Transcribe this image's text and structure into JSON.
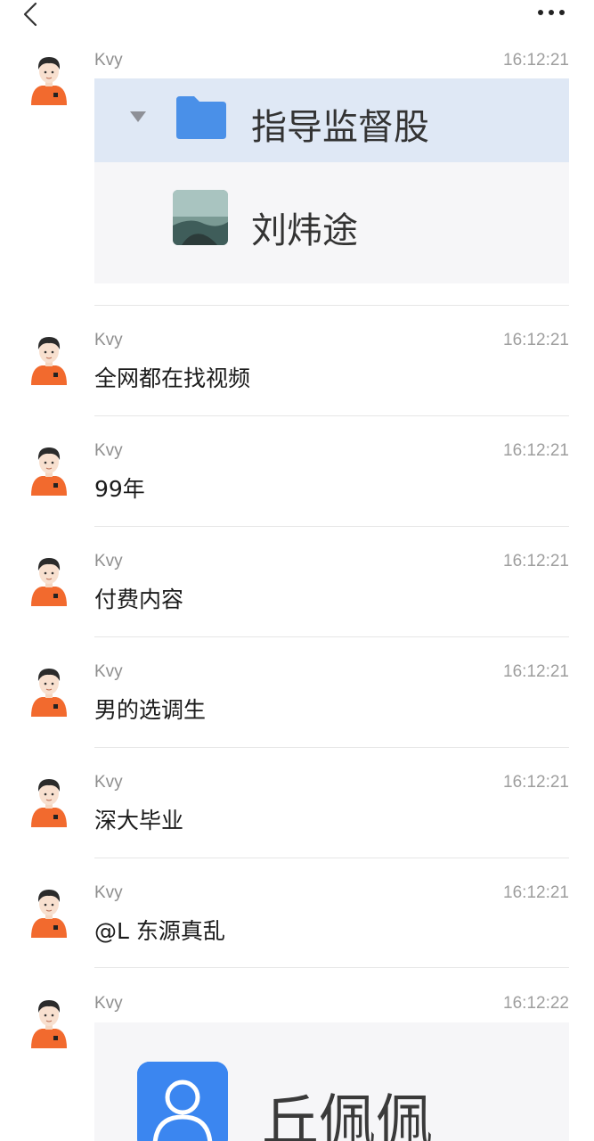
{
  "header": {
    "back_icon": "chevron-left-icon",
    "more_icon": "more-dots-icon"
  },
  "colors": {
    "avatar_shirt": "#f26a2e",
    "selection_bg": "#dfe8f5",
    "folder_blue": "#4a90e8",
    "contact_blue": "#3b86f0"
  },
  "messages": [
    {
      "sender": "Kvy",
      "time": "16:12:21",
      "type": "image",
      "content": {
        "group_name": "指导监督股",
        "user_name": "刘炜途"
      }
    },
    {
      "sender": "Kvy",
      "time": "16:12:21",
      "type": "text",
      "text": "全网都在找视频"
    },
    {
      "sender": "Kvy",
      "time": "16:12:21",
      "type": "text",
      "text": "99年"
    },
    {
      "sender": "Kvy",
      "time": "16:12:21",
      "type": "text",
      "text": "付费内容"
    },
    {
      "sender": "Kvy",
      "time": "16:12:21",
      "type": "text",
      "text": "男的选调生"
    },
    {
      "sender": "Kvy",
      "time": "16:12:21",
      "type": "text",
      "text": "深大毕业"
    },
    {
      "sender": "Kvy",
      "time": "16:12:21",
      "type": "text",
      "text": "@L 东源真乱"
    },
    {
      "sender": "Kvy",
      "time": "16:12:22",
      "type": "image",
      "content": {
        "contact_name": "丘佩佩"
      }
    }
  ]
}
